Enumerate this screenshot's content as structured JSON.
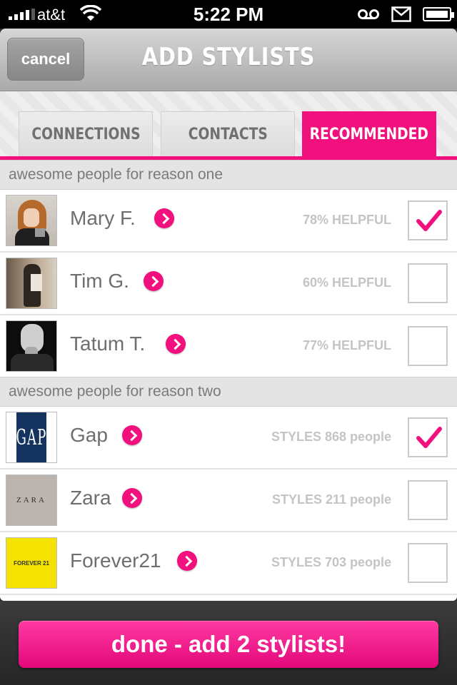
{
  "status_bar": {
    "carrier": "at&t",
    "time": "5:22 PM"
  },
  "nav": {
    "cancel_label": "cancel",
    "title": "ADD STYLISTS"
  },
  "tabs": [
    {
      "label": "CONNECTIONS",
      "active": false
    },
    {
      "label": "CONTACTS",
      "active": false
    },
    {
      "label": "RECOMMENDED",
      "active": true
    }
  ],
  "sections": [
    {
      "header": "awesome people for reason one",
      "rows": [
        {
          "name": "Mary F.",
          "stat": "78% HELPFUL",
          "checked": true,
          "avatar": "person-photo"
        },
        {
          "name": "Tim G.",
          "stat": "60% HELPFUL",
          "checked": false,
          "avatar": "person-photo"
        },
        {
          "name": "Tatum T.",
          "stat": "77% HELPFUL",
          "checked": false,
          "avatar": "person-photo"
        }
      ]
    },
    {
      "header": "awesome people for reason two",
      "rows": [
        {
          "name": "Gap",
          "stat": "STYLES 868 people",
          "checked": true,
          "avatar": "GAP"
        },
        {
          "name": "Zara",
          "stat": "STYLES 211 people",
          "checked": false,
          "avatar": "ZARA"
        },
        {
          "name": "Forever21",
          "stat": "STYLES 703 people",
          "checked": false,
          "avatar": "FOREVER 21"
        }
      ]
    }
  ],
  "done_button": "done - add 2 stylists!",
  "colors": {
    "accent": "#f2107f",
    "text": "#6e6e6e",
    "stat": "#c4c4c4",
    "section_bg": "#e4e4e4"
  },
  "icons": {
    "row_action": "chevron-right-icon",
    "selected": "checkmark-icon"
  }
}
